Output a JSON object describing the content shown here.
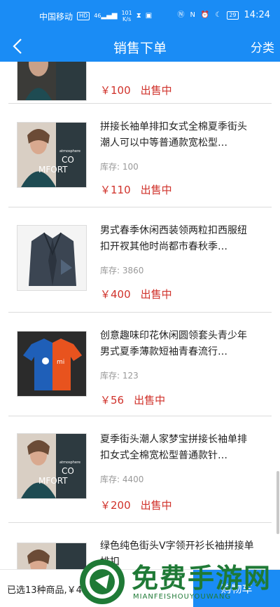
{
  "status_bar": {
    "carrier": "中国移动",
    "hd_badge": "HD",
    "network": "46",
    "net_speed_value": "101",
    "net_speed_unit": "K/s",
    "nfc_label": "N",
    "battery": "29",
    "time": "14:24"
  },
  "nav": {
    "title": "销售下单",
    "right_label": "分类"
  },
  "products": [
    {
      "name": "",
      "stock_label": "",
      "stock": "",
      "price": "￥100",
      "status": "出售中",
      "image": "girl-comfort"
    },
    {
      "name": "拼接长袖单排扣女式全棉夏季街头潮人可以中等普通款宽松型…",
      "stock_label": "库存:",
      "stock": "100",
      "price": "￥110",
      "status": "出售中",
      "image": "girl-comfort"
    },
    {
      "name": "男式春季休闲西装领两粒扣西服纽扣开衩其他时尚都市春秋季…",
      "stock_label": "库存:",
      "stock": "3860",
      "price": "￥400",
      "status": "出售中",
      "image": "suit"
    },
    {
      "name": "创意趣味印花休闲圆领套头青少年男式夏季薄款短袖青春流行…",
      "stock_label": "库存:",
      "stock": "123",
      "price": "￥56",
      "status": "出售中",
      "image": "tshirt"
    },
    {
      "name": "夏季街头潮人家梦宝拼接长袖单排扣女式全棉宽松型普通款针…",
      "stock_label": "库存:",
      "stock": "4400",
      "price": "￥200",
      "status": "出售中",
      "image": "girl-comfort"
    },
    {
      "name": "绿色纯色街头V字领开衫长袖拼接单排扣",
      "stock_label": "",
      "stock": "",
      "price": "",
      "status": "",
      "image": "girl-comfort"
    }
  ],
  "image_text": {
    "comfort_line1": "CO",
    "comfort_line2": "MFORT",
    "comfort_small": "atmosphere",
    "comfort_num": "20 17",
    "tshirt_logo": "mi"
  },
  "bottom_bar": {
    "summary": "已选13种商品,￥40 ,   0元",
    "cart_button": "购物车"
  },
  "watermark": {
    "title": "免费手游网",
    "subtitle": "MIANFEISHOUYOUWANG"
  },
  "colors": {
    "brand_blue": "#1a8cf5",
    "price_red": "#d0322b",
    "watermark_green": "#1f7a36"
  }
}
